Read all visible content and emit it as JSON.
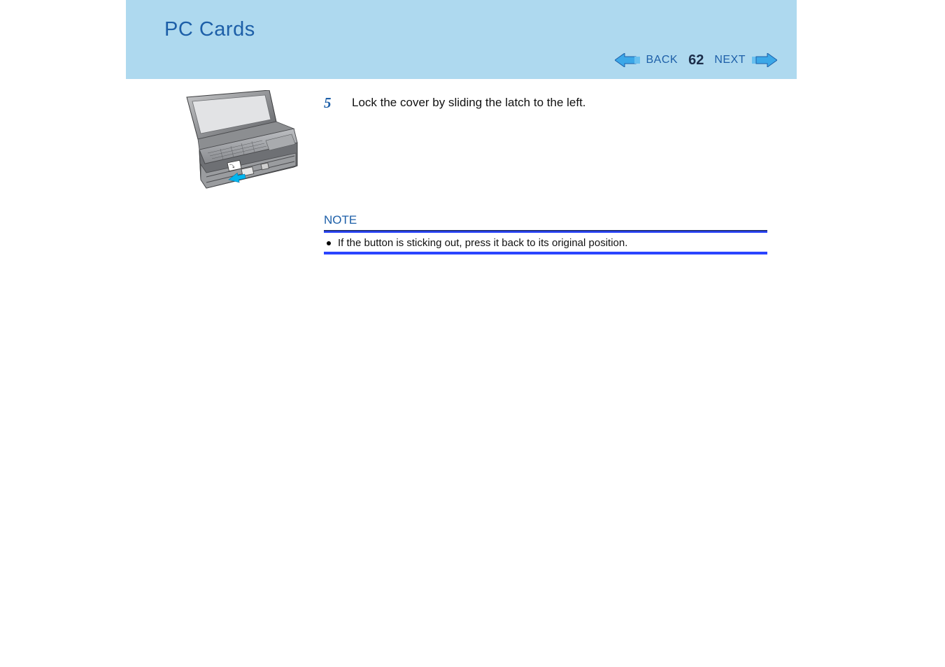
{
  "header": {
    "title": "PC Cards"
  },
  "nav": {
    "back_label": "BACK",
    "page_number": "62",
    "next_label": "NEXT"
  },
  "step": {
    "number": "5",
    "text": "Lock the cover by sliding the latch to the left."
  },
  "note": {
    "heading": "NOTE",
    "item": "If the button is sticking out, press it back to its original position."
  }
}
